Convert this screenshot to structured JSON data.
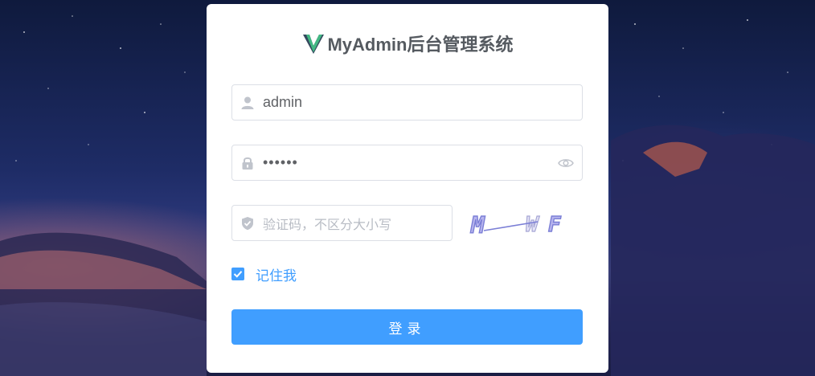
{
  "app": {
    "title": "MyAdmin后台管理系统"
  },
  "form": {
    "username": {
      "value": "admin",
      "icon": "user-icon"
    },
    "password": {
      "value": "••••••",
      "icon": "lock-icon",
      "toggle_icon": "eye-icon"
    },
    "captcha": {
      "placeholder": "验证码，不区分大小写",
      "icon": "shield-icon",
      "image_text": "M WF"
    },
    "remember": {
      "label": "记住我",
      "checked": true
    },
    "submit_label": "登录"
  },
  "colors": {
    "primary": "#409eff",
    "title": "#555a60",
    "logo_green": "#42b883",
    "logo_dark": "#35495e"
  }
}
